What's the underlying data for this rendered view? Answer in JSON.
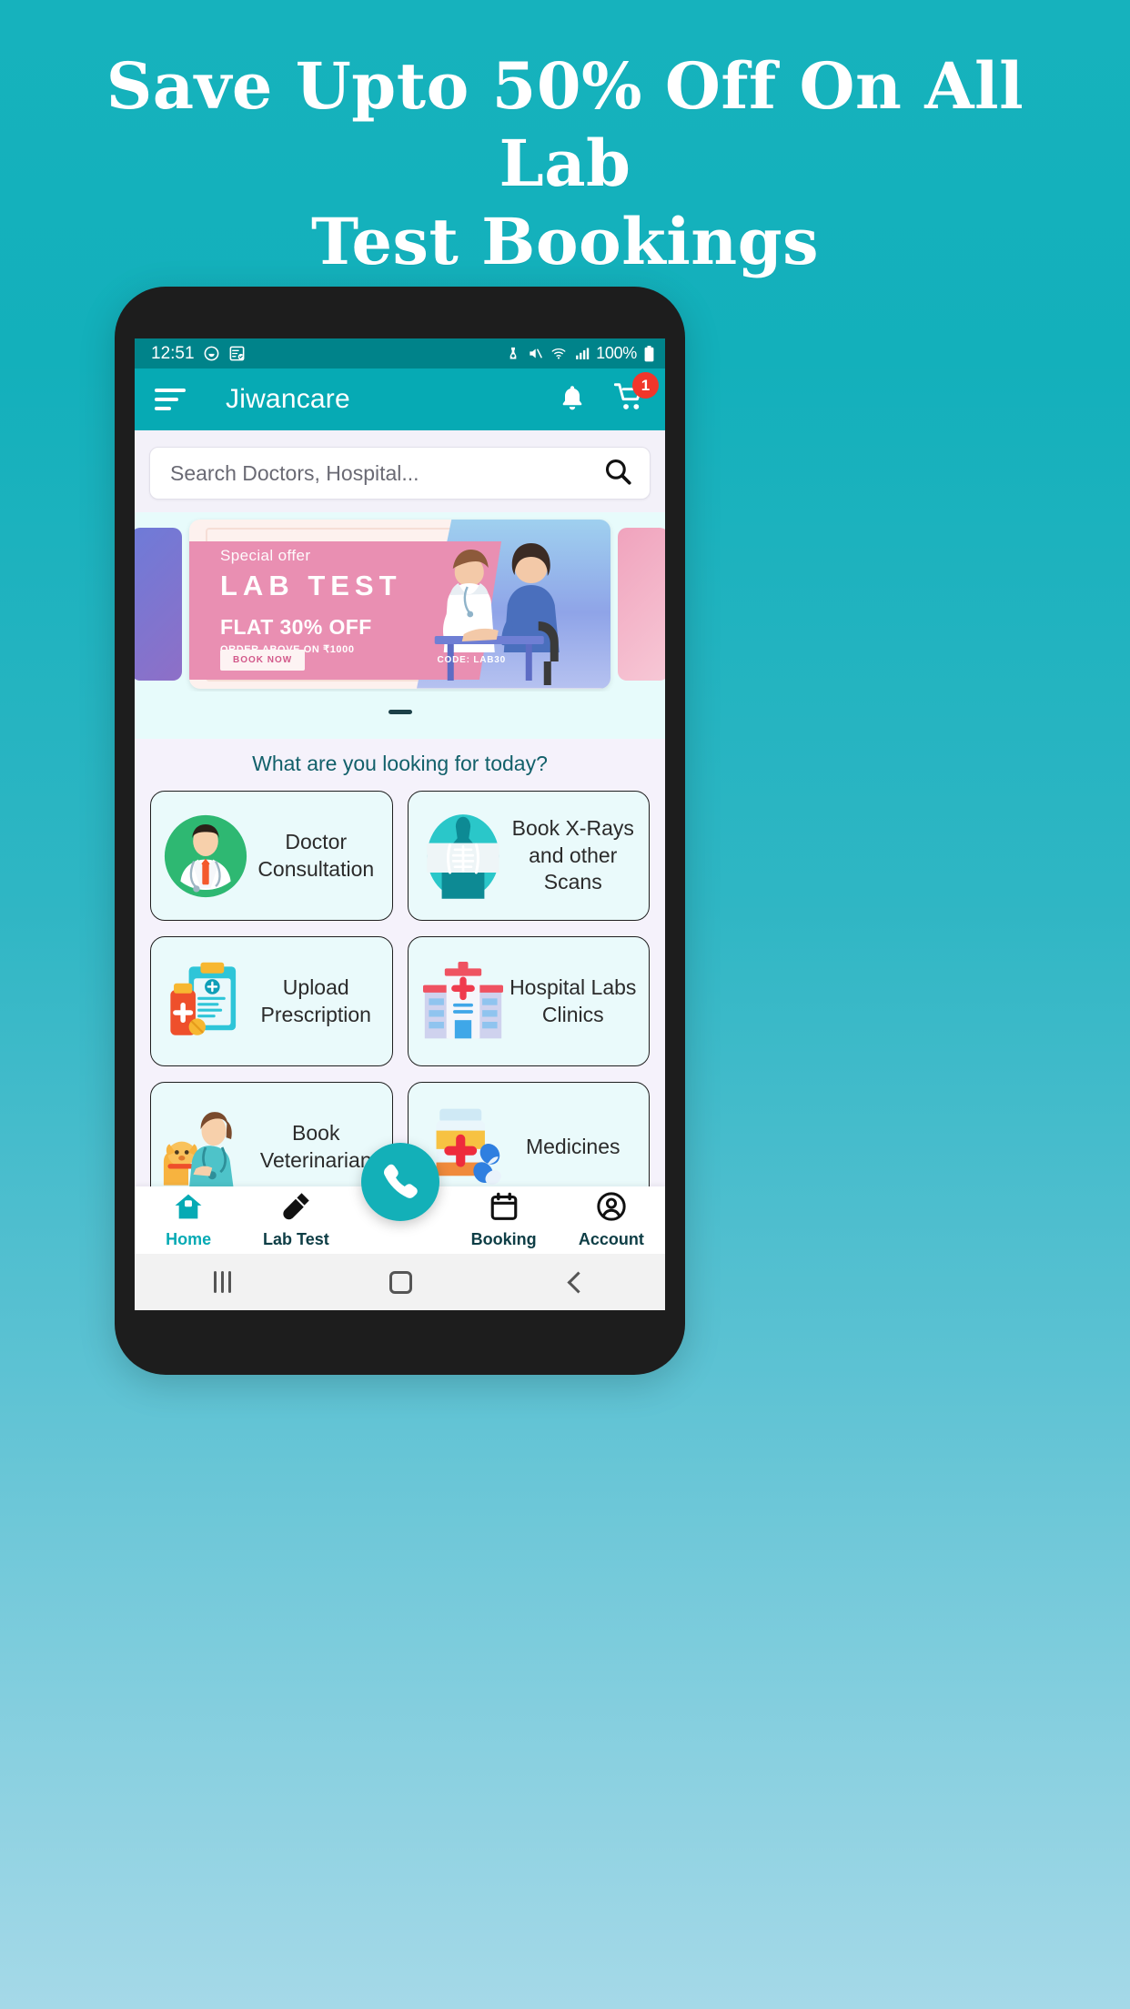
{
  "promo": {
    "line1": "Save Upto 50% Off On All Lab",
    "line2": "Test Bookings"
  },
  "colors": {
    "background_top": "#16b2bd",
    "background_bottom": "#a5d9e8",
    "appbar": "#06aab4",
    "statusbar": "#00838a",
    "accent": "#13b0b8",
    "badge_red": "#f1362b",
    "tile_bg": "#eafafb",
    "heading_teal": "#12606a"
  },
  "statusbar": {
    "time": "12:51",
    "battery_percent": "100%",
    "icons_left": [
      "alarm-icon",
      "tasks-icon"
    ],
    "icons_right": [
      "dnd-icon",
      "mute-icon",
      "wifi-icon",
      "signal-icon",
      "battery-icon"
    ]
  },
  "appbar": {
    "menu_icon": "hamburger-menu-icon",
    "title": "Jiwancare",
    "notification_icon": "bell-icon",
    "cart_icon": "shopping-cart-icon",
    "cart_badge": "1"
  },
  "search": {
    "placeholder": "Search Doctors, Hospital...",
    "value": "",
    "icon": "search-icon"
  },
  "banner": {
    "special": "Special offer",
    "title": "LAB TEST",
    "discount": "FLAT 30% OFF",
    "condition": "ORDER ABOVE ON  ₹1000",
    "cta": "BOOK NOW",
    "code": "CODE: LAB30",
    "page_indicator": "1"
  },
  "categories": {
    "heading": "What are you looking for today?",
    "items": [
      {
        "label": "Doctor\nConsultation",
        "line1": "Doctor",
        "line2": "Consultation",
        "icon": "doctor-avatar-icon"
      },
      {
        "label": "Book X-Rays and other Scans",
        "line1": "Book X-Rays",
        "line2": "and other Scans",
        "icon": "xray-scan-icon"
      },
      {
        "label": "Upload Prescription",
        "line1": "Upload",
        "line2": "Prescription",
        "icon": "prescription-upload-icon"
      },
      {
        "label": "Hospital Labs Clinics",
        "line1": "Hospital Labs",
        "line2": "Clinics",
        "icon": "hospital-building-icon"
      },
      {
        "label": "Book Veterinarian",
        "line1": "Book",
        "line2": "Veterinarian",
        "icon": "veterinarian-icon"
      },
      {
        "label": "Medicines",
        "line1": "Medicines",
        "line2": "",
        "icon": "medicine-bottle-icon"
      }
    ]
  },
  "bottom_nav": {
    "items": [
      {
        "label": "Home",
        "icon": "home-icon",
        "active": true
      },
      {
        "label": "Lab Test",
        "icon": "test-tube-icon",
        "active": false
      },
      {
        "label": "Booking",
        "icon": "calendar-icon",
        "active": false
      },
      {
        "label": "Account",
        "icon": "account-circle-icon",
        "active": false
      }
    ],
    "fab_icon": "phone-call-icon"
  },
  "android_nav": {
    "recent_icon": "recent-apps-icon",
    "home_icon": "home-square-icon",
    "back_icon": "back-chevron-icon"
  }
}
